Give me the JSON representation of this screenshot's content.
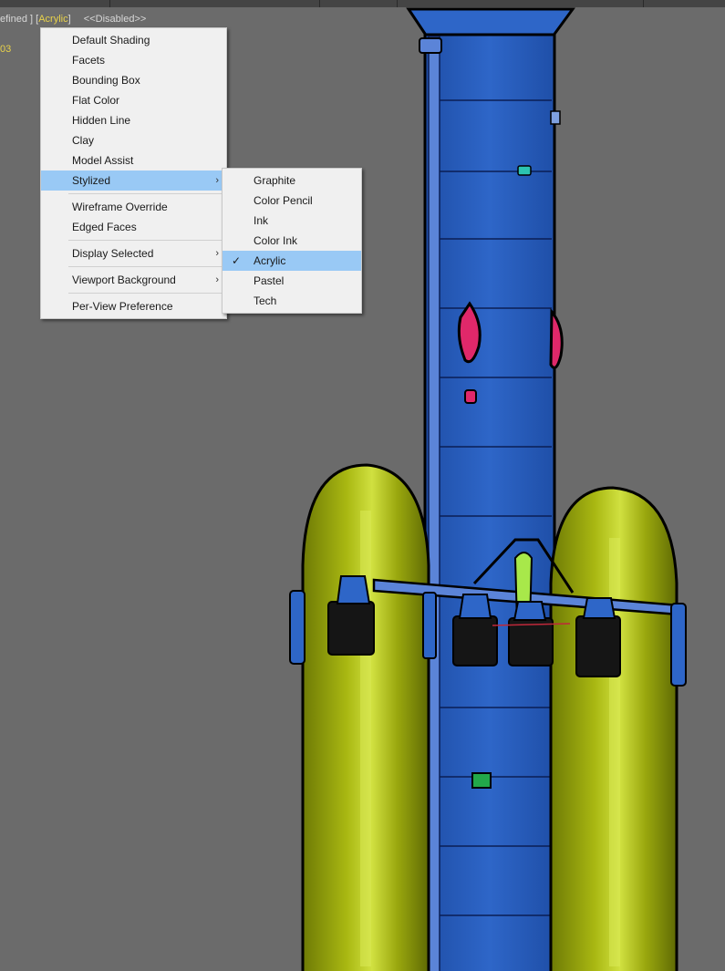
{
  "viewport": {
    "label_prefix": "efined ]",
    "label_open": "[",
    "label_shading": "Acrylic",
    "label_close": "]",
    "label_disabled": "<<Disabled>>",
    "stat_text": "03",
    "background_color": "#6b6b6b"
  },
  "main_menu": {
    "items": [
      {
        "label": "Default Shading"
      },
      {
        "label": "Facets"
      },
      {
        "label": "Bounding Box"
      },
      {
        "label": "Flat Color"
      },
      {
        "label": "Hidden Line"
      },
      {
        "label": "Clay"
      },
      {
        "label": "Model Assist"
      },
      {
        "label": "Stylized",
        "submenu": true,
        "highlighted": true
      },
      {
        "label": "Wireframe Override"
      },
      {
        "label": "Edged Faces"
      },
      {
        "label": "Display Selected",
        "submenu": true
      },
      {
        "label": "Viewport Background",
        "submenu": true
      },
      {
        "label": "Per-View Preference"
      }
    ],
    "arrow_glyph": "›"
  },
  "sub_menu": {
    "items": [
      {
        "label": "Graphite"
      },
      {
        "label": "Color Pencil"
      },
      {
        "label": "Ink"
      },
      {
        "label": "Color Ink"
      },
      {
        "label": "Acrylic",
        "checked": true,
        "highlighted": true
      },
      {
        "label": "Pastel"
      },
      {
        "label": "Tech"
      }
    ],
    "check_glyph": "✓"
  },
  "colors": {
    "highlight": "#99c9f5",
    "core_stage": "#2b62c4",
    "side_booster": "#9aa80e",
    "accent_pink": "#e0286a",
    "accent_green": "#22a84a"
  }
}
